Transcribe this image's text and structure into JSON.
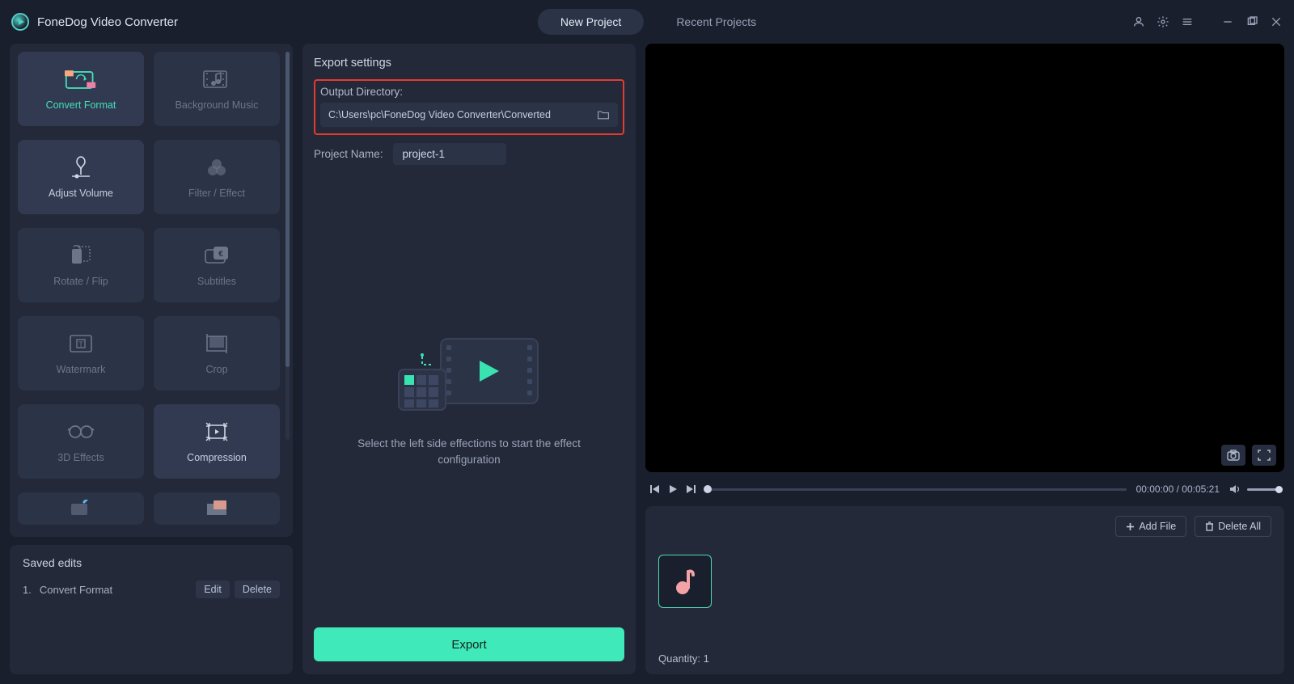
{
  "app": {
    "title": "FoneDog Video Converter"
  },
  "tabs": {
    "new_project": "New Project",
    "recent": "Recent Projects"
  },
  "sidebar": {
    "tiles": [
      {
        "label": "Convert Format",
        "icon": "convert"
      },
      {
        "label": "Background Music",
        "icon": "music"
      },
      {
        "label": "Adjust Volume",
        "icon": "volume"
      },
      {
        "label": "Filter / Effect",
        "icon": "filter"
      },
      {
        "label": "Rotate / Flip",
        "icon": "rotate"
      },
      {
        "label": "Subtitles",
        "icon": "subtitles"
      },
      {
        "label": "Watermark",
        "icon": "watermark"
      },
      {
        "label": "Crop",
        "icon": "crop"
      },
      {
        "label": "3D Effects",
        "icon": "3d"
      },
      {
        "label": "Compression",
        "icon": "compress"
      }
    ]
  },
  "saved": {
    "title": "Saved edits",
    "items": [
      {
        "num": "1.",
        "label": "Convert Format"
      }
    ],
    "edit_btn": "Edit",
    "delete_btn": "Delete"
  },
  "export": {
    "title": "Export settings",
    "outdir_label": "Output Directory:",
    "outdir_value": "C:\\Users\\pc\\FoneDog Video Converter\\Converted",
    "projname_label": "Project Name:",
    "projname_value": "project-1",
    "hint": "Select the left side effections to start the effect configuration",
    "button": "Export"
  },
  "player": {
    "time": "00:00:00 / 00:05:21"
  },
  "files": {
    "add": "Add File",
    "delete_all": "Delete All",
    "quantity_label": "Quantity: 1"
  }
}
